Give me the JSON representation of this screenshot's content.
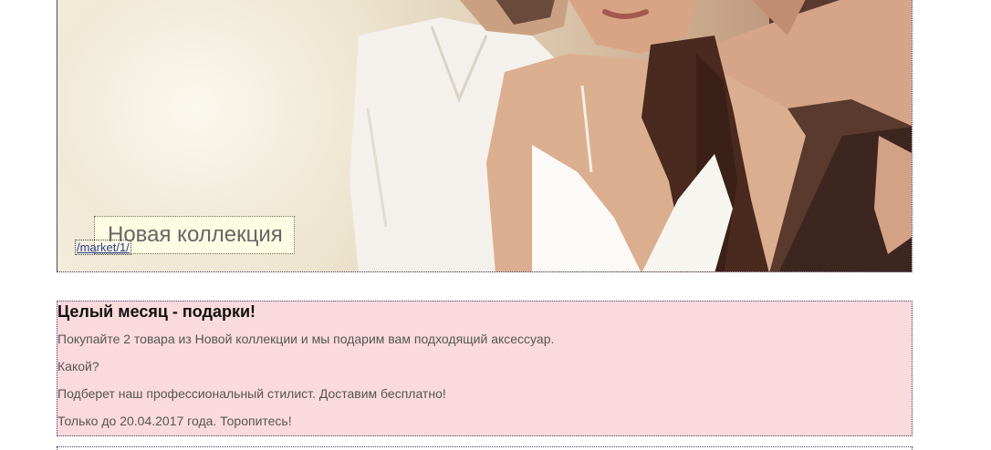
{
  "hero": {
    "image_alt_icon": "couple-photo",
    "collection_label": "Новая коллекция",
    "link_text": "/market/1/"
  },
  "promo": {
    "title": "Целый месяц - подарки!",
    "lines": [
      "Покупайте 2 товара из Новой коллекции и мы подарим вам подходящий аксессуар.",
      "Какой?",
      "Подберет наш профессиональный стилист. Доставим бесплатно!",
      "Только до 20.04.2017 года. Торопитесь!"
    ],
    "background_color": "#fbdadd"
  }
}
